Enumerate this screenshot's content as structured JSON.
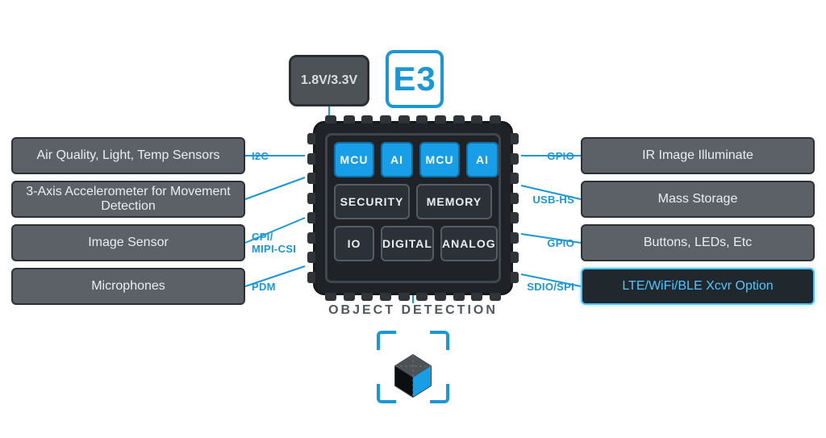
{
  "voltage_label": "1.8V/3.3V",
  "badge": "E3",
  "caption": "OBJECT DETECTION",
  "left_boxes": [
    "Air Quality, Light, Temp Sensors",
    "3-Axis Accelerometer for Movement Detection",
    "Image Sensor",
    "Microphones"
  ],
  "left_buses": [
    "I2C",
    "",
    "CPI/\nMIPI-CSI",
    "PDM"
  ],
  "right_boxes": [
    "IR Image Illuminate",
    "Mass Storage",
    "Buttons, LEDs, Etc",
    "LTE/WiFi/BLE Xcvr Option"
  ],
  "right_box_highlight": [
    false,
    false,
    false,
    true
  ],
  "right_buses": [
    "GPIO",
    "USB-HS",
    "GPIO",
    "SDIO/SPI"
  ],
  "chip": {
    "row0": [
      "MCU",
      "AI",
      "MCU",
      "AI"
    ],
    "row1": [
      "SECURITY",
      "MEMORY"
    ],
    "row2": [
      "IO",
      "DIGITAL",
      "ANALOG"
    ]
  }
}
